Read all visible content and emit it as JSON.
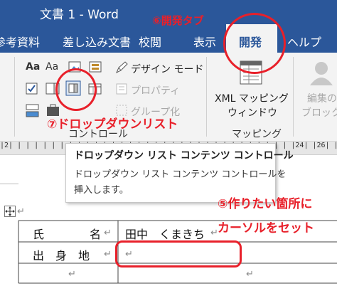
{
  "window": {
    "title": "文書 1  -  Word"
  },
  "tabs": {
    "references": "参考資料",
    "mailings": "差し込み文書",
    "review": "校閲",
    "view": "表示",
    "developer": "開発",
    "help": "ヘルプ"
  },
  "ribbon": {
    "design_mode": "デザイン モード",
    "properties": "プロパティ",
    "group": "グループ化",
    "xml_mapping_pane_line1": "XML マッピング",
    "xml_mapping_pane_line2": "ウィンドウ",
    "controls_group": "コントロール",
    "mapping_group": "マッピング",
    "protect_line1": "編集の",
    "protect_line2": "ブロック"
  },
  "ruler": {
    "text": "|2|  |  |  |  |  |  |  |  |  |  |  |  |  |  |  |  |  |  |  |  |  |  |  |  |  |  |  |  |  |  |  |  |  |24|  |26|  |28|"
  },
  "tooltip": {
    "title": "ドロップダウン リスト コンテンツ コントロール",
    "body_line1": "ドロップダウン リスト コンテンツ コントロールを",
    "body_line2": "挿入します。"
  },
  "table": {
    "rows": [
      {
        "label": "氏　　　　名",
        "value": "田中　くまきち"
      },
      {
        "label": "出　身　地",
        "value": ""
      },
      {
        "label": "",
        "value": ""
      }
    ],
    "return_mark": "↵"
  },
  "annotations": {
    "developer_tab": "⑥開発タブ",
    "dropdown_list": "⑦ドロップダウンリスト",
    "cursor_line1": "⑤作りたい箇所に",
    "cursor_line2": "カーソルをセット"
  },
  "colors": {
    "word_blue": "#2b579a",
    "annotation_red": "#e8202a"
  }
}
